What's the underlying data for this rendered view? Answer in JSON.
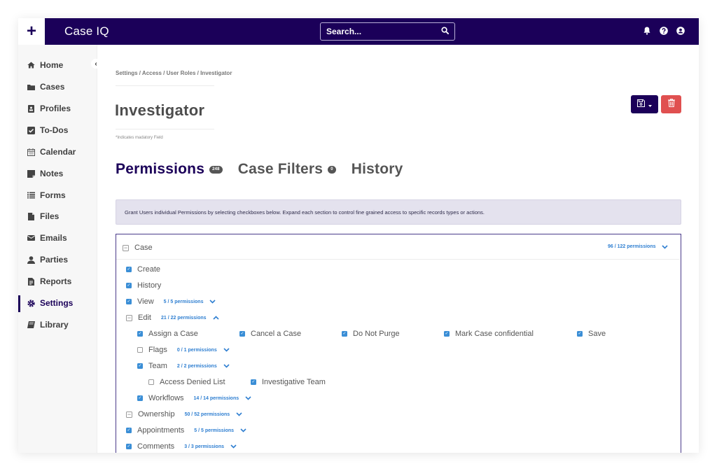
{
  "app": {
    "brand": "Case IQ",
    "new_label": "+",
    "search_placeholder": "Search..."
  },
  "topbar_icons": [
    "bell-icon",
    "help-icon",
    "user-icon"
  ],
  "sidebar": {
    "collapse_label": "‹",
    "items": [
      {
        "label": "Home",
        "icon": "home-icon",
        "active": false
      },
      {
        "label": "Cases",
        "icon": "folder-icon",
        "active": false
      },
      {
        "label": "Profiles",
        "icon": "id-card-icon",
        "active": false
      },
      {
        "label": "To-Dos",
        "icon": "checkbox-icon",
        "active": false
      },
      {
        "label": "Calendar",
        "icon": "calendar-icon",
        "active": false
      },
      {
        "label": "Notes",
        "icon": "note-icon",
        "active": false
      },
      {
        "label": "Forms",
        "icon": "list-icon",
        "active": false
      },
      {
        "label": "Files",
        "icon": "file-icon",
        "active": false
      },
      {
        "label": "Emails",
        "icon": "envelope-icon",
        "active": false
      },
      {
        "label": "Parties",
        "icon": "person-icon",
        "active": false
      },
      {
        "label": "Reports",
        "icon": "report-icon",
        "active": false
      },
      {
        "label": "Settings",
        "icon": "gear-icon",
        "active": true
      },
      {
        "label": "Library",
        "icon": "book-icon",
        "active": false
      }
    ]
  },
  "breadcrumb": "Settings / Access / User Roles / Investigator",
  "page_title": "Investigator",
  "mandatory_note": "*Indicates madatory Field",
  "tabs": [
    {
      "label": "Permissions",
      "badge": "248",
      "active": true
    },
    {
      "label": "Case Filters",
      "badge": "0",
      "active": false
    },
    {
      "label": "History",
      "badge": null,
      "active": false
    }
  ],
  "info_text": "Grant Users individual Permissions by selecting checkboxes below. Expand each section to control fine grained access to specific records types or actions.",
  "permissions": {
    "section": {
      "label": "Case",
      "count": "96 / 122 permissions",
      "state": "partial"
    },
    "rows": [
      {
        "label": "Create",
        "state": "checked",
        "count": null
      },
      {
        "label": "History",
        "state": "checked",
        "count": null
      },
      {
        "label": "View",
        "state": "checked",
        "count": "5 / 5 permissions",
        "expanded": false
      },
      {
        "label": "Edit",
        "state": "partial",
        "count": "21 / 22 permissions",
        "expanded": true
      },
      {
        "label": "Ownership",
        "state": "partial",
        "count": "50 / 52 permissions",
        "expanded": false
      },
      {
        "label": "Appointments",
        "state": "checked",
        "count": "5 / 5 permissions",
        "expanded": false
      },
      {
        "label": "Comments",
        "state": "checked",
        "count": "3 / 3 permissions",
        "expanded": false
      }
    ],
    "edit_children": [
      {
        "label": "Assign a Case",
        "state": "checked"
      },
      {
        "label": "Cancel a Case",
        "state": "checked"
      },
      {
        "label": "Do Not Purge",
        "state": "checked"
      },
      {
        "label": "Mark Case confidential",
        "state": "checked"
      },
      {
        "label": "Save",
        "state": "checked"
      }
    ],
    "edit_groups": [
      {
        "label": "Flags",
        "state": "unchecked",
        "count": "0 / 1 permissions"
      },
      {
        "label": "Team",
        "state": "checked",
        "count": "2 / 2 permissions"
      },
      {
        "label": "Workflows",
        "state": "checked",
        "count": "14 / 14 permissions"
      }
    ],
    "team_children": [
      {
        "label": "Access Denied List",
        "state": "unchecked"
      },
      {
        "label": "Investigative Team",
        "state": "checked"
      }
    ]
  },
  "colors": {
    "brand": "#1b0059",
    "danger": "#e05050",
    "checkbox": "#3a8ed6",
    "link": "#2f7fd1",
    "banner_bg": "#e4e2ee"
  }
}
